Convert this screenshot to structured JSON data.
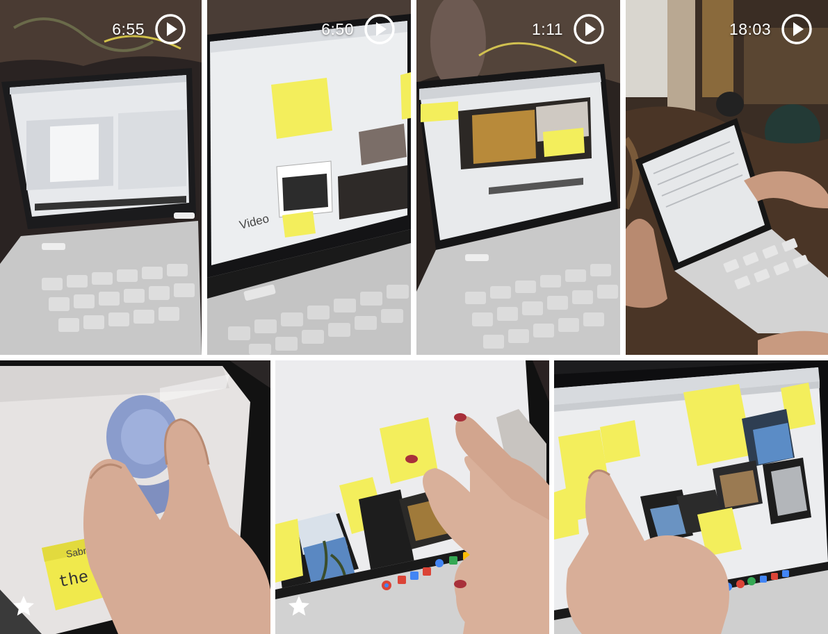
{
  "gallery": {
    "videos": [
      {
        "duration": "6:55",
        "icon": "play-circle-icon"
      },
      {
        "duration": "6:50",
        "icon": "play-circle-icon"
      },
      {
        "duration": "1:11",
        "icon": "play-circle-icon"
      },
      {
        "duration": "18:03",
        "icon": "play-circle-icon"
      }
    ],
    "photos": [
      {
        "favorite": true,
        "icon": "star-icon"
      },
      {
        "favorite": true,
        "icon": "star-icon"
      },
      {
        "favorite": false
      }
    ]
  },
  "colors": {
    "note_yellow": "#f3ee5c",
    "screen_white": "#e9ebee",
    "keyboard_gray": "#c9c9c9",
    "skin": "#dcb39c",
    "background": "#ffffff"
  }
}
